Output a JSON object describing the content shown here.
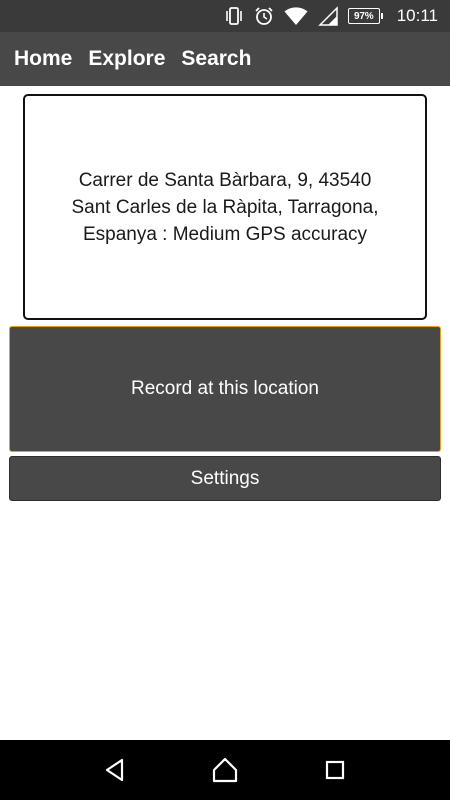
{
  "status_bar": {
    "icons": [
      "vibrate-icon",
      "alarm-icon",
      "wifi-icon",
      "signal-icon"
    ],
    "battery_percent": "97%",
    "time": "10:11"
  },
  "nav": {
    "items": [
      {
        "label": "Home"
      },
      {
        "label": "Explore"
      },
      {
        "label": "Search"
      }
    ]
  },
  "address": {
    "line1": "Carrer de Santa Bàrbara, 9, 43540",
    "line2": "Sant Carles de la Ràpita, Tarragona,",
    "line3": "Espanya : Medium GPS accuracy"
  },
  "actions": {
    "record_label": "Record at this location",
    "settings_label": "Settings"
  },
  "system_nav": {
    "buttons": [
      "back-icon",
      "home-icon",
      "recents-icon"
    ]
  },
  "colors": {
    "status_bar": "#3a3a3a",
    "nav_bar": "#484848",
    "button_bg": "#484848",
    "record_border": "#e7a21a",
    "system_nav_bg": "#000000"
  }
}
